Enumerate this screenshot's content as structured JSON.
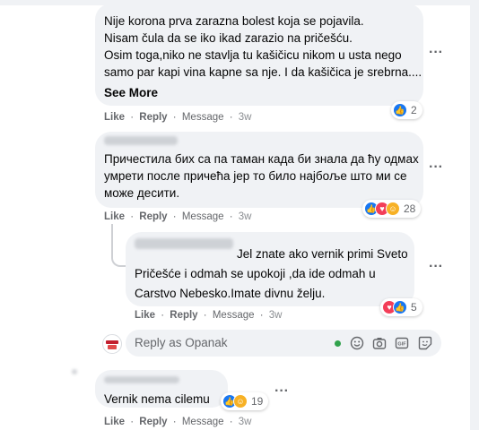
{
  "comments": [
    {
      "lines": [
        "Nije korona prva zarazna bolest koja se pojavila.",
        "Nisam čula da se iko ikad zarazio na pričešću.",
        "Osim toga,niko ne stavlja tu kašičicu nikom u usta nego",
        "samo par kapi vina kapne sa nje. I da kašičica je srebrna...."
      ],
      "see_more": "See More",
      "like": "Like",
      "reply": "Reply",
      "message": "Message",
      "time": "3w",
      "reaction_count": "2"
    },
    {
      "lines": [
        "Причестила бих са па таман када би знала да ћу одмах",
        "умрети после причећа јер то било најбоље што ми се",
        "може десити."
      ],
      "like": "Like",
      "reply": "Reply",
      "message": "Message",
      "time": "3w",
      "reaction_count": "28"
    },
    {
      "lines": [
        "Jel znate ako vernik primi Sveto",
        "Pričešće i odmah se upokoji ,da ide odmah u",
        "Carstvo Nebesko.Imate divnu želju."
      ],
      "like": "Like",
      "reply": "Reply",
      "message": "Message",
      "time": "3w",
      "reaction_count": "5"
    },
    {
      "lines": [
        "Vernik nema cilemu"
      ],
      "like": "Like",
      "reply": "Reply",
      "message": "Message",
      "time": "3w",
      "reaction_count": "19"
    }
  ],
  "reply_input": {
    "placeholder": "Reply as Opanak"
  },
  "separator": "·",
  "icons": [
    "like-icon",
    "love-icon",
    "care-icon",
    "more-icon",
    "emoji-icon",
    "camera-icon",
    "gif-icon",
    "sticker-icon"
  ],
  "colors": {
    "bubble": "#f0f2f5",
    "like": "#1877f2",
    "love": "#f33e58",
    "care": "#f7b125",
    "meta": "#65676b",
    "online": "#31a24c"
  }
}
